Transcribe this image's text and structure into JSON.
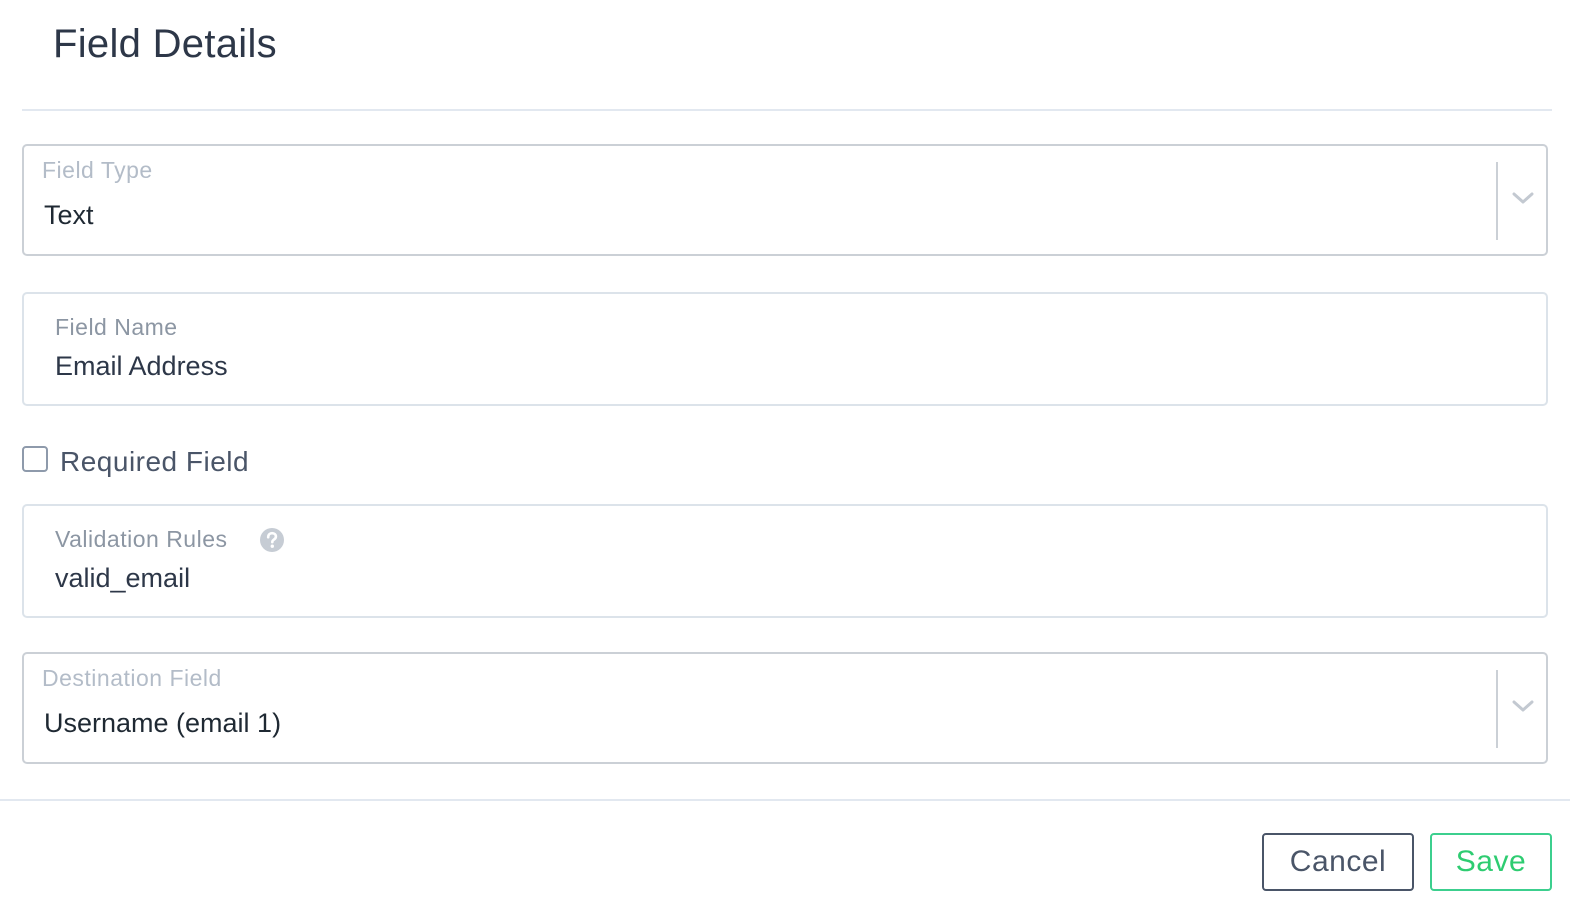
{
  "dialog": {
    "title": "Field Details"
  },
  "field_type": {
    "label": "Field Type",
    "value": "Text",
    "icon": "chevron-down-icon"
  },
  "field_name": {
    "label": "Field Name",
    "value": "Email Address"
  },
  "required": {
    "label": "Required Field",
    "checked": false
  },
  "validation_rules": {
    "label": "Validation Rules",
    "value": "valid_email",
    "icon": "help-icon"
  },
  "destination_field": {
    "label": "Destination Field",
    "value": "Username (email 1)",
    "icon": "chevron-down-icon"
  },
  "actions": {
    "cancel_label": "Cancel",
    "save_label": "Save"
  },
  "colors": {
    "save_accent": "#2ecc71",
    "cancel_border": "#4a5568",
    "text_dark": "#2d3748",
    "label_muted": "#8c96a3",
    "divider": "#e2e8f0"
  }
}
